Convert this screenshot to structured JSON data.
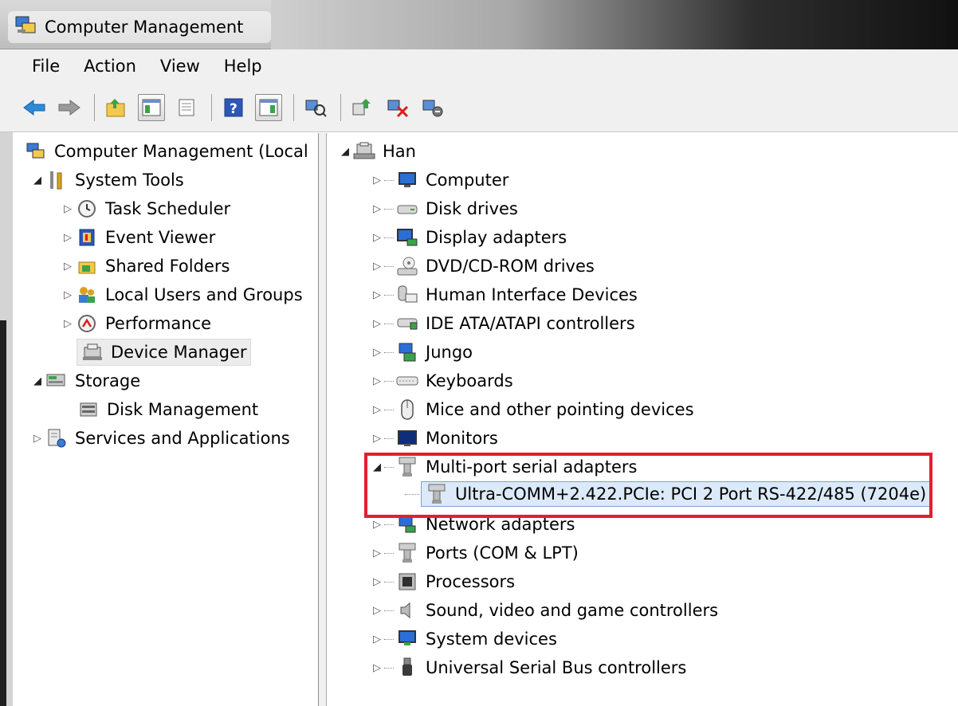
{
  "window": {
    "title": "Computer Management"
  },
  "menu": [
    "File",
    "Action",
    "View",
    "Help"
  ],
  "toolbar": {
    "icons": [
      "back-arrow-icon",
      "forward-arrow-icon",
      "up-folder-icon",
      "show-hide-tree-icon",
      "properties-icon",
      "help-icon",
      "show-hide-action-pane-icon",
      "scan-hardware-icon",
      "update-driver-icon",
      "uninstall-device-icon",
      "disable-device-icon"
    ]
  },
  "left_tree": {
    "root": "Computer Management (Local",
    "system_tools": "System Tools",
    "task_scheduler": "Task Scheduler",
    "event_viewer": "Event Viewer",
    "shared_folders": "Shared Folders",
    "local_users": "Local Users and Groups",
    "performance": "Performance",
    "device_manager": "Device Manager",
    "storage": "Storage",
    "disk_management": "Disk Management",
    "services": "Services and Applications"
  },
  "device_tree": {
    "root": "Han",
    "categories": [
      "Computer",
      "Disk drives",
      "Display adapters",
      "DVD/CD-ROM drives",
      "Human Interface Devices",
      "IDE ATA/ATAPI controllers",
      "Jungo",
      "Keyboards",
      "Mice and other pointing devices",
      "Monitors",
      "Multi-port serial adapters",
      "Network adapters",
      "Ports (COM & LPT)",
      "Processors",
      "Sound, video and game controllers",
      "System devices",
      "Universal Serial Bus controllers"
    ],
    "selected_device": "Ultra-COMM+2.422.PCIe: PCI 2 Port RS-422/485 (7204e)"
  },
  "toggles": {
    "open": "◢",
    "closed": "▷"
  },
  "colors": {
    "highlight_box": "#e0202e",
    "selection_bg": "#dce9f8"
  }
}
